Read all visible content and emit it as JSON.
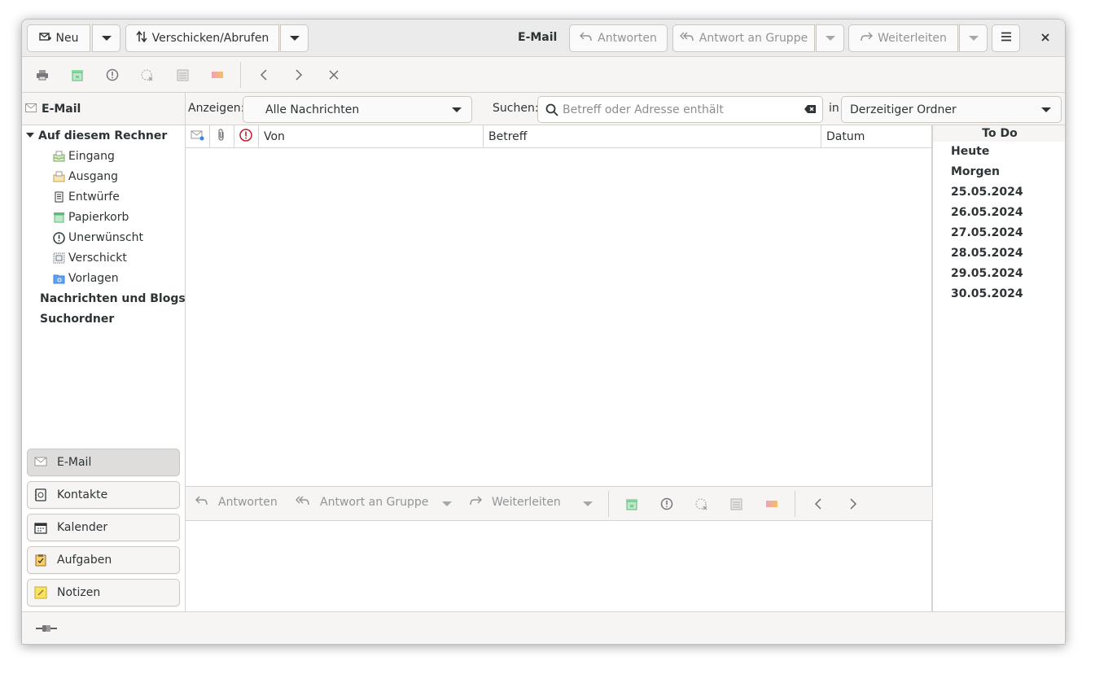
{
  "header": {
    "new_label": "Neu",
    "sync_label": "Verschicken/Abrufen",
    "title": "E-Mail",
    "reply_label": "Antworten",
    "reply_all_label": "Antwort an Gruppe",
    "forward_label": "Weiterleiten"
  },
  "folder_pane": {
    "title": "E-Mail",
    "account": "Auf diesem Rechner",
    "folders": [
      "Eingang",
      "Ausgang",
      "Entwürfe",
      "Papierkorb",
      "Unerwünscht",
      "Verschickt",
      "Vorlagen"
    ],
    "other_accounts": [
      "Nachrichten und Blogs",
      "Suchordner"
    ]
  },
  "switcher": {
    "items": [
      "E-Mail",
      "Kontakte",
      "Kalender",
      "Aufgaben",
      "Notizen"
    ]
  },
  "filter": {
    "show_label": "Anzeigen:",
    "show_value": "Alle Nachrichten",
    "search_label": "Suchen:",
    "search_placeholder": "Betreff oder Adresse enthält",
    "scope_label": "in",
    "scope_value": "Derzeitiger Ordner"
  },
  "message_list": {
    "columns": [
      "Von",
      "Betreff",
      "Datum"
    ]
  },
  "todo": {
    "title": "To Do",
    "items": [
      "Heute",
      "Morgen",
      "25.05.2024",
      "26.05.2024",
      "27.05.2024",
      "28.05.2024",
      "29.05.2024",
      "30.05.2024"
    ]
  },
  "preview_bar": {
    "reply_label": "Antworten",
    "reply_all_label": "Antwort an Gruppe",
    "forward_label": "Weiterleiten"
  },
  "icons": {
    "print": "printer-icon",
    "delete": "trash-icon",
    "junk": "junk-icon",
    "not_junk": "not-junk-icon",
    "archive": "archive-icon",
    "label": "label-icon",
    "previous": "chevron-left-icon",
    "next": "chevron-right-icon",
    "stop": "close-icon"
  }
}
